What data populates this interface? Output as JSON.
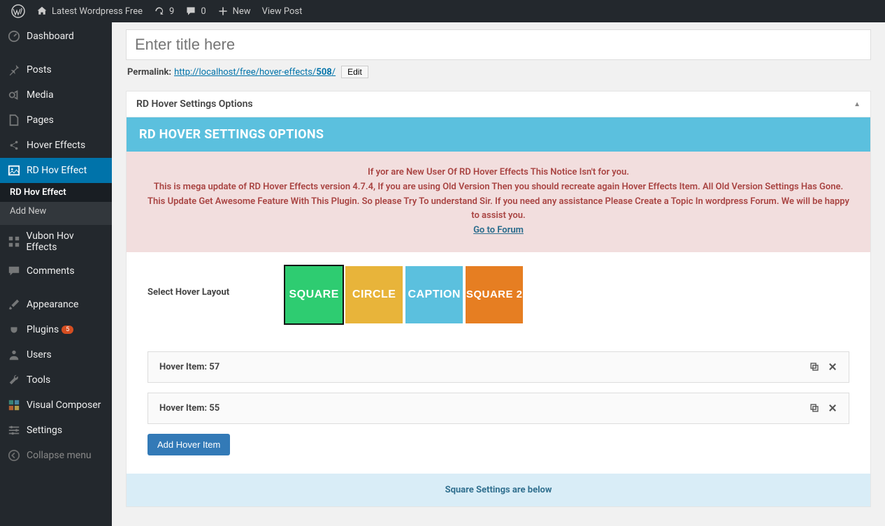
{
  "adminbar": {
    "site_name": "Latest Wordpress Free",
    "update_count": "9",
    "comment_count": "0",
    "new_label": "New",
    "view_post": "View Post"
  },
  "sidebar": {
    "dashboard": "Dashboard",
    "posts": "Posts",
    "media": "Media",
    "pages": "Pages",
    "hover_effects": "Hover Effects",
    "rd_hov_effect": "RD Hov Effect",
    "rd_hov_effect_sub": "RD Hov Effect",
    "add_new": "Add New",
    "vubon": "Vubon Hov Effects",
    "comments": "Comments",
    "appearance": "Appearance",
    "plugins": "Plugins",
    "plugins_badge": "5",
    "users": "Users",
    "tools": "Tools",
    "visual_composer": "Visual Composer",
    "settings": "Settings",
    "collapse": "Collapse menu"
  },
  "editor": {
    "title_placeholder": "Enter title here",
    "permalink_label": "Permalink:",
    "permalink_base": "http://localhost/free/hover-effects/",
    "permalink_id": "508",
    "permalink_slash": "/",
    "edit": "Edit"
  },
  "metabox": {
    "header": "RD Hover Settings Options",
    "banner": "RD HOVER SETTINGS OPTIONS",
    "notice_line1": "If yor are New User Of RD Hover Effects This Notice Isn't for you.",
    "notice_line2": "This is mega update of RD Hover Effects version 4.7.4, If you are using Old Version Then you should recreate again Hover Effects Item. All Old Version Settings Has Gone. This Update Get Awesome Feature With This Plugin. So please Try To understand Sir. If you need any assistance Please Create a Topic In wordpress Forum. We will be happy to assist you.",
    "forum_link": "Go to Forum",
    "select_layout": "Select Hover Layout",
    "layouts": {
      "square": "SQUARE",
      "circle": "CIRCLE",
      "caption": "CAPTION",
      "square2": "SQUARE 2"
    },
    "item1": "Hover Item: 57",
    "item2": "Hover Item: 55",
    "add_item": "Add Hover Item",
    "footer": "Square Settings are below"
  }
}
